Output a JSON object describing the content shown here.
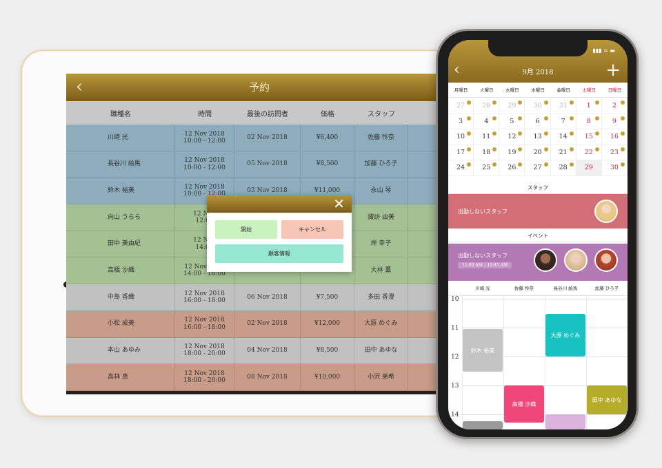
{
  "tablet": {
    "title": "予約",
    "back_icon": "chevron-left-icon",
    "columns": [
      "職種名",
      "時間",
      "最後の訪問者",
      "価格",
      "スタッフ"
    ],
    "rows": [
      {
        "name": "川崎 光",
        "date": "12 Nov 2018",
        "time": "10:00 - 12:00",
        "last_visit": "02 Nov 2018",
        "price": "¥6,400",
        "staff": "佐藤 怜奈",
        "color": "#8dadbd"
      },
      {
        "name": "長谷川 絵馬",
        "date": "12 Nov 2018",
        "time": "10:00 - 12:00",
        "last_visit": "05 Nov 2018",
        "price": "¥8,500",
        "staff": "加藤 ひろ子",
        "color": "#8dadbd"
      },
      {
        "name": "鈴木 裕美",
        "date": "12 Nov 2018",
        "time": "10:00 - 12:00",
        "last_visit": "03 Nov 2018",
        "price": "¥11,000",
        "staff": "永山 琴",
        "color": "#8dadbd"
      },
      {
        "name": "向山 うらら",
        "date": "12 Nov",
        "time": "12:00",
        "last_visit": "",
        "price": "",
        "staff": "諏訪 由美",
        "color": "#a3c193"
      },
      {
        "name": "田中 美由紀",
        "date": "12 Nov",
        "time": "14:00",
        "last_visit": "",
        "price": "",
        "staff": "岸 幸子",
        "color": "#a3c193"
      },
      {
        "name": "高橋 沙織",
        "date": "12 Nov 2018",
        "time": "14:00 - 16:00",
        "last_visit": "",
        "price": "",
        "staff": "大林 薫",
        "color": "#a3c193"
      },
      {
        "name": "中島 香織",
        "date": "12 Nov 2018",
        "time": "16:00 - 18:00",
        "last_visit": "06 Nov 2018",
        "price": "¥7,500",
        "staff": "多田 香澄",
        "color": "#c1c1c1"
      },
      {
        "name": "小松 成美",
        "date": "12 Nov 2018",
        "time": "16:00 - 18:00",
        "last_visit": "02 Nov 2018",
        "price": "¥12,000",
        "staff": "大原 めぐみ",
        "color": "#c89c88"
      },
      {
        "name": "本山 あゆみ",
        "date": "12 Nov 2018",
        "time": "18:00 - 20:00",
        "last_visit": "04 Nov 2018",
        "price": "¥8,500",
        "staff": "田中 あゆな",
        "color": "#c1c1c1"
      },
      {
        "name": "高林 恵",
        "date": "12 Nov 2018",
        "time": "18:00 - 20:00",
        "last_visit": "08 Nov 2018",
        "price": "¥10,000",
        "staff": "小沢 美希",
        "color": "#c89c88"
      }
    ],
    "popup": {
      "close_icon": "close-icon",
      "start_label": "開始",
      "cancel_label": "キャンセル",
      "customer_info_label": "顧客情報"
    }
  },
  "phone": {
    "status_time": "",
    "month_title": "9月 2018",
    "back_icon": "chevron-left-icon",
    "add_icon": "plus-icon",
    "weekdays": [
      "月曜日",
      "火曜日",
      "水曜日",
      "木曜日",
      "金曜日",
      "土曜日",
      "日曜日"
    ],
    "calendar": [
      [
        {
          "d": "27",
          "dim": true,
          "dot": true
        },
        {
          "d": "28",
          "dim": true,
          "dot": true
        },
        {
          "d": "29",
          "dim": true,
          "dot": true
        },
        {
          "d": "30",
          "dim": true,
          "dot": true
        },
        {
          "d": "31",
          "dim": true,
          "dot": true
        },
        {
          "d": "1",
          "red": true,
          "dot": true
        },
        {
          "d": "2",
          "red": true,
          "dot": true
        }
      ],
      [
        {
          "d": "3",
          "dot": true
        },
        {
          "d": "4",
          "dot": true
        },
        {
          "d": "5",
          "dot": true
        },
        {
          "d": "6",
          "dot": true
        },
        {
          "d": "7",
          "dot": true
        },
        {
          "d": "8",
          "red": true,
          "dot": true
        },
        {
          "d": "9",
          "red": true,
          "dot": true
        }
      ],
      [
        {
          "d": "10",
          "dot": true
        },
        {
          "d": "11",
          "dot": true
        },
        {
          "d": "12",
          "dot": true
        },
        {
          "d": "13",
          "dot": true
        },
        {
          "d": "14",
          "dot": true
        },
        {
          "d": "15",
          "red": true,
          "dot": true
        },
        {
          "d": "16",
          "red": true,
          "dot": true
        }
      ],
      [
        {
          "d": "17",
          "dot": true
        },
        {
          "d": "18",
          "dot": true
        },
        {
          "d": "19",
          "dot": true
        },
        {
          "d": "20",
          "dot": true
        },
        {
          "d": "21",
          "dot": true
        },
        {
          "d": "22",
          "red": true,
          "dot": true
        },
        {
          "d": "23",
          "red": true,
          "dot": true
        }
      ],
      [
        {
          "d": "24",
          "dot": true
        },
        {
          "d": "25",
          "dot": true
        },
        {
          "d": "26",
          "dot": true
        },
        {
          "d": "27",
          "dot": true
        },
        {
          "d": "28",
          "dot": true
        },
        {
          "d": "29",
          "red": true,
          "today": true,
          "dot": false
        },
        {
          "d": "30",
          "red": true,
          "dot": true
        }
      ]
    ],
    "staff_section_label": "スタッフ",
    "staff_bar_text": "出勤しないスタッフ",
    "event_section_label": "イベント",
    "event_bar_text": "出勤しないスタッフ",
    "event_time": "11:00 AM – 11:45 AM",
    "schedule_staff": [
      "川崎 光",
      "佐藤 怜奈",
      "長谷川 絵馬",
      "加藤 ひろ子"
    ],
    "hours": [
      "10",
      "11",
      "12",
      "13",
      "14"
    ],
    "appointments": [
      {
        "name": "鈴木 裕美",
        "color": "#c3c3c3"
      },
      {
        "name": "大原 めぐみ",
        "color": "#18c2c2"
      },
      {
        "name": "高橋 沙織",
        "color": "#f0467a"
      },
      {
        "name": "田中 あゆな",
        "color": "#b5ad2a"
      }
    ]
  }
}
